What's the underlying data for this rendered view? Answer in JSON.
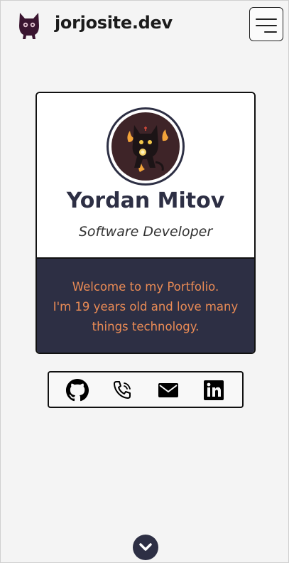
{
  "header": {
    "title": "jorjosite.dev",
    "logo_icon": "cat-logo-icon",
    "menu_icon": "hamburger-menu-icon"
  },
  "profile": {
    "name": "Yordan Mitov",
    "role": "Software Developer",
    "avatar_icon": "demon-cat-avatar"
  },
  "welcome": {
    "line1": "Welcome to my Portfolio.",
    "line2": "I'm 19 years old and love many things technology."
  },
  "socials": [
    {
      "icon": "github-icon"
    },
    {
      "icon": "phone-icon"
    },
    {
      "icon": "email-icon"
    },
    {
      "icon": "linkedin-icon"
    }
  ],
  "scroll_icon": "chevron-down-icon",
  "colors": {
    "navy": "#2d2f44",
    "accent_orange": "#ea8b55",
    "background": "#f4f4f4",
    "logo_purple": "#3a1530"
  }
}
